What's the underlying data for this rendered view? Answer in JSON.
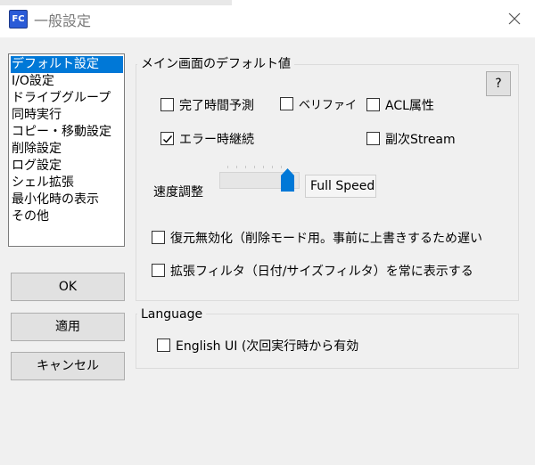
{
  "window": {
    "app_icon_text": "FC",
    "title": "一般設定",
    "close_symbol": "✕"
  },
  "sidebar": {
    "items": [
      {
        "label": "デフォルト設定",
        "selected": true
      },
      {
        "label": "I/O設定"
      },
      {
        "label": "ドライブグループ"
      },
      {
        "label": "同時実行"
      },
      {
        "label": "コピー・移動設定"
      },
      {
        "label": "削除設定"
      },
      {
        "label": "ログ設定"
      },
      {
        "label": "シェル拡張"
      },
      {
        "label": "最小化時の表示"
      },
      {
        "label": "その他"
      }
    ]
  },
  "buttons": {
    "ok": "OK",
    "apply": "適用",
    "cancel": "キャンセル"
  },
  "main_group": {
    "label": "メイン画面のデフォルト値",
    "help": "?",
    "checkboxes": {
      "estimate": {
        "label": "完了時間予測",
        "checked": false
      },
      "verify": {
        "label": "ベリファイ",
        "checked": false
      },
      "acl": {
        "label": "ACL属性",
        "checked": false
      },
      "continue_on_error": {
        "label": "エラー時継続",
        "checked": true
      },
      "alt_stream": {
        "label": "副次Stream",
        "checked": false
      },
      "disable_restore": {
        "label": "復元無効化（削除モード用。事前に上書きするため遅い",
        "checked": false
      },
      "ext_filter": {
        "label": "拡張フィルタ（日付/サイズフィルタ）を常に表示する",
        "checked": false
      }
    },
    "speed": {
      "label": "速度調整",
      "value_text": "Full Speed",
      "level": 1.0
    }
  },
  "language_group": {
    "label": "Language",
    "english_ui": {
      "label": "English UI (次回実行時から有効",
      "checked": false
    }
  },
  "colors": {
    "selection": "#0078d7",
    "slider_thumb": "#0078d7"
  }
}
